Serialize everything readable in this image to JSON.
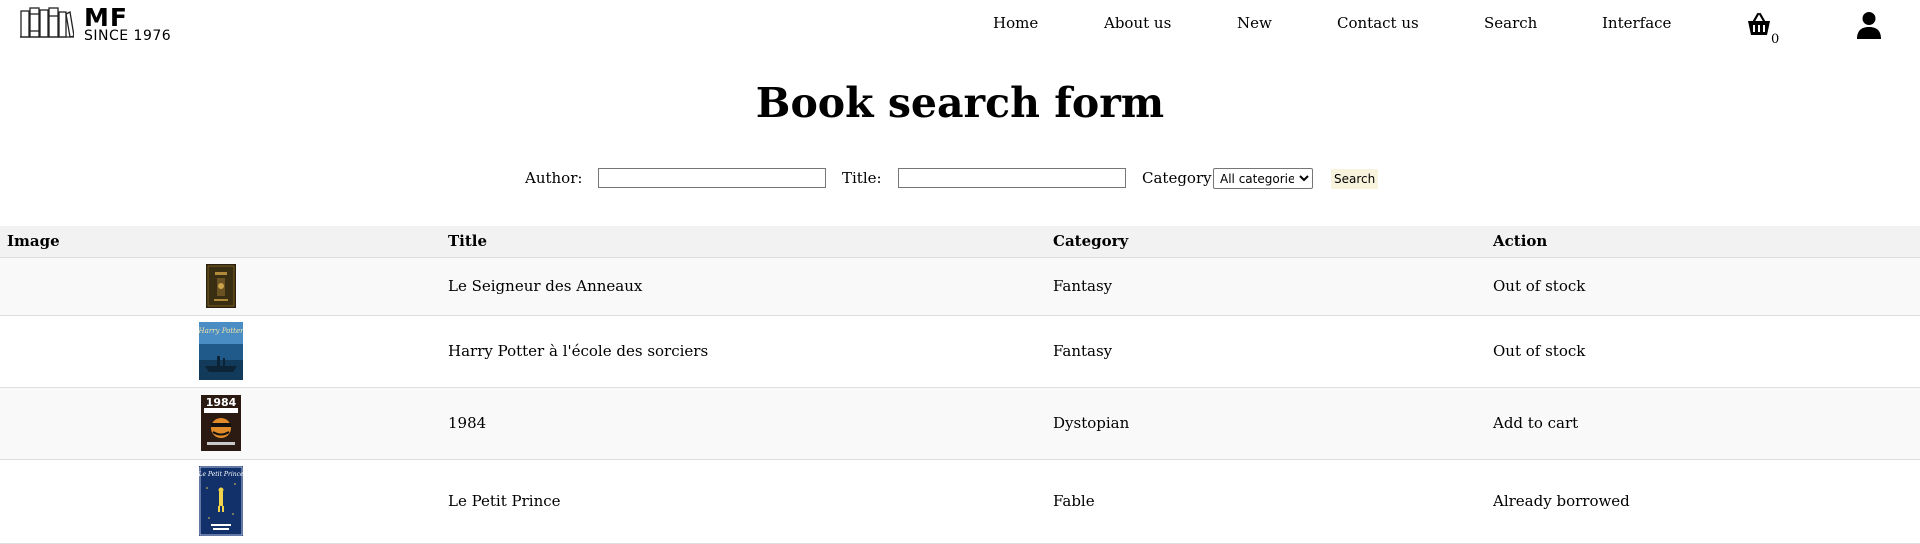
{
  "header": {
    "logo_title": "MF",
    "logo_subtitle": "SINCE 1976",
    "nav": [
      {
        "label": "Home"
      },
      {
        "label": "About us"
      },
      {
        "label": "New"
      },
      {
        "label": "Contact us"
      },
      {
        "label": "Search"
      },
      {
        "label": "Interface"
      }
    ],
    "cart_count": "0",
    "icons": {
      "cart": "basket-icon",
      "user": "user-icon",
      "logo": "books-logo-icon"
    }
  },
  "page": {
    "title": "Book search form"
  },
  "form": {
    "author_label": "Author:",
    "author_value": "",
    "title_label": "Title:",
    "title_value": "",
    "category_label": "Category:",
    "category_selected": "All categories",
    "search_label": "Search"
  },
  "table": {
    "headers": [
      "Image",
      "Title",
      "Category",
      "Action"
    ],
    "rows": [
      {
        "title": "Le Seigneur des Anneaux",
        "category": "Fantasy",
        "action": "Out of stock",
        "cover": "lotr-cover",
        "cover_color": "#3a2e12"
      },
      {
        "title": "Harry Potter à l'école des sorciers",
        "category": "Fantasy",
        "action": "Out of stock",
        "cover": "harry-potter-cover",
        "cover_color": "#1f5a8a"
      },
      {
        "title": "1984",
        "category": "Dystopian",
        "action": "Add to cart",
        "cover": "1984-cover",
        "cover_color": "#2a1a12"
      },
      {
        "title": "Le Petit Prince",
        "category": "Fable",
        "action": "Already borrowed",
        "cover": "petit-prince-cover",
        "cover_color": "#12306a"
      }
    ]
  },
  "colors": {
    "header_bg": "#f2f2f2",
    "row_alt_bg": "#f9f9f9",
    "search_button_bg": "#f7f3dc"
  }
}
